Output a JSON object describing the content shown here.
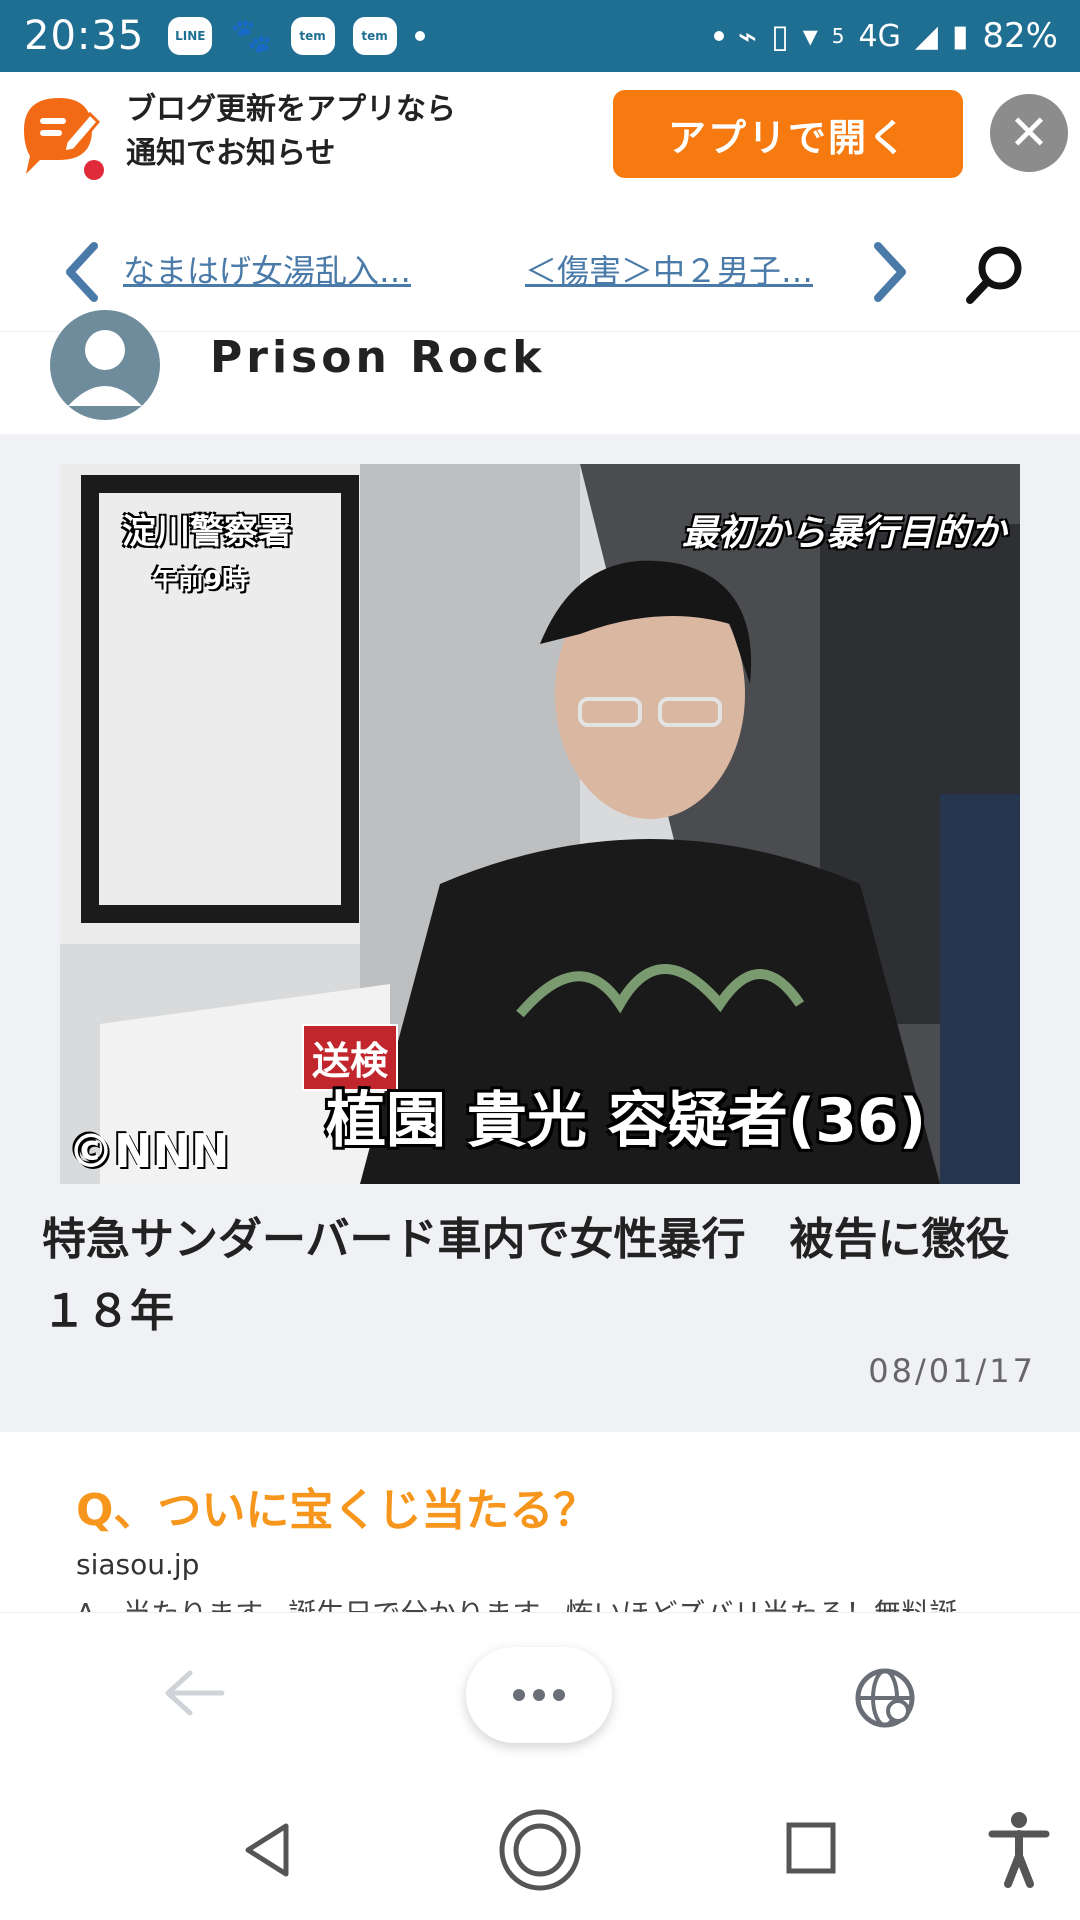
{
  "status_bar": {
    "time": "20:35",
    "app_badges": [
      "LINE",
      "tem",
      "tem"
    ],
    "network": "4G",
    "signal_label": "5",
    "battery": "82%"
  },
  "app_banner": {
    "text_line1": "ブログ更新をアプリなら",
    "text_line2": "通知でお知らせ",
    "open_button": "アプリで開く",
    "close_symbol": "✕"
  },
  "article_nav": {
    "prev_title": "なまはげ女湯乱入…",
    "next_title": "＜傷害＞中２男子…"
  },
  "blog": {
    "name": "Prison Rock"
  },
  "article": {
    "photo_captions": {
      "top_left": "淀川警察署",
      "top_left_sub": "午前9時",
      "top_right": "最初から暴行目的か",
      "send_label": "送検",
      "name_caption": "植園 貴光 容疑者(36)",
      "copyright": "©NNN"
    },
    "title": "特急サンダーバード車内で女性暴行　被告に懲役１８年",
    "date": "08/01/17"
  },
  "ad": {
    "title": "Q、ついに宝くじ当たる？",
    "domain": "siasou.jp",
    "description": "A、当たります。誕生日で分かります。怖いほどズバリ当たる！無料誕"
  },
  "icons": {
    "prev": "chevron-left-icon",
    "next": "chevron-right-icon",
    "search": "search-icon",
    "back": "arrow-left-icon",
    "menu": "more-dots-icon",
    "globe": "globe-icon"
  },
  "colors": {
    "status_bar": "#1f6f93",
    "accent_orange": "#f77a10",
    "link_blue": "#4a7aa8",
    "ad_title": "#f7961c"
  }
}
